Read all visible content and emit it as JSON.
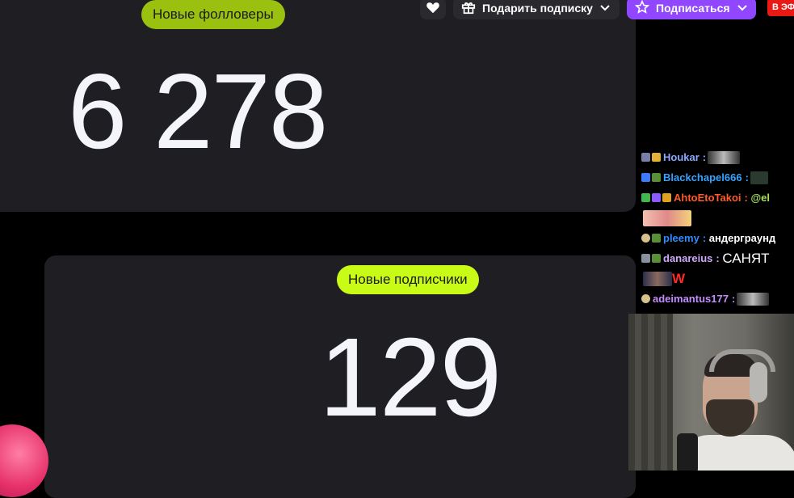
{
  "followers": {
    "label": "Новые фолловеры",
    "value": "6 278"
  },
  "subscribers": {
    "label": "Новые подписчики",
    "value": "129"
  },
  "header_buttons": {
    "heart_icon": "heart-icon",
    "gift_label": "Подарить подписку",
    "subscribe_label": "Подписаться",
    "live_label": "В ЭФ"
  },
  "chat": [
    {
      "user": "Houkar",
      "color": "#8aa7ff",
      "message": ""
    },
    {
      "user": "Blackchapel666",
      "color": "#35a3ff",
      "message": ""
    },
    {
      "user": "AhtoEtoTakoi",
      "color": "#ff5a2a",
      "message": "@el"
    },
    {
      "user": "pleemy",
      "color": "#2f8cff",
      "message": "андерграунд"
    },
    {
      "user": "danareius",
      "color": "#d2a8ff",
      "message": "САНЯТ"
    },
    {
      "user": "adeimantus177",
      "color": "#c58cff",
      "message": ""
    }
  ],
  "chat_extra": {
    "w_text": "W"
  },
  "colors": {
    "accent_green": "#c8fb16",
    "twitch_purple": "#9147ff",
    "live_red": "#e91916"
  }
}
